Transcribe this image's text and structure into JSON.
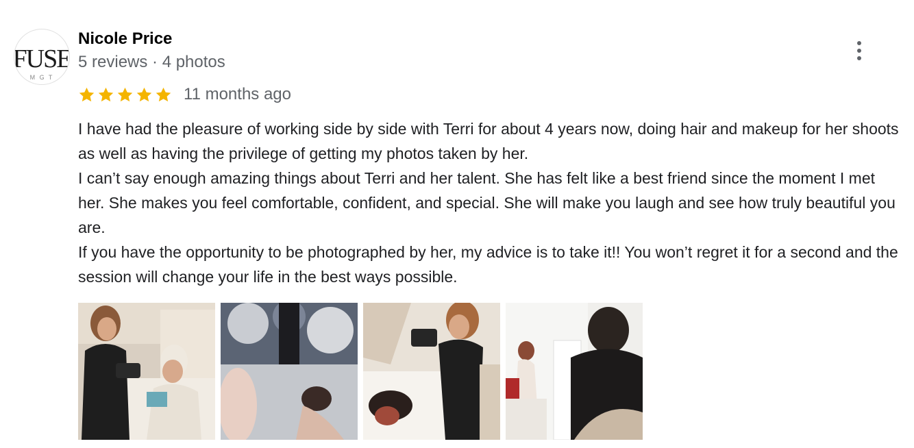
{
  "reviewer": {
    "name": "Nicole Price",
    "meta": "5 reviews · 4 photos",
    "avatar_logo_text": "FUSE",
    "avatar_logo_subtext": "M G T"
  },
  "rating": {
    "stars": 5,
    "max_stars": 5,
    "star_color": "#f4b400",
    "date": "11 months ago"
  },
  "review": {
    "paragraphs": [
      "I have had the pleasure of working side by side with Terri for about 4 years now, doing hair and makeup for her shoots as well as having the privilege of getting my photos taken by her.",
      "I can’t say enough amazing things about Terri and her talent. She has felt like a best friend since the moment I met her.  She makes you feel comfortable, confident, and special.  She will make you laugh and see how truly beautiful you are.",
      "If you have the opportunity to be photographed by her, my advice is to take it!! You won’t regret it for a second and the session will change your life in the best ways possible."
    ]
  },
  "photos": [
    {
      "alt": "review-photo-1"
    },
    {
      "alt": "review-photo-2"
    },
    {
      "alt": "review-photo-3"
    },
    {
      "alt": "review-photo-4"
    }
  ],
  "icons": {
    "more_options": "more-vert-icon",
    "star": "star-icon"
  }
}
